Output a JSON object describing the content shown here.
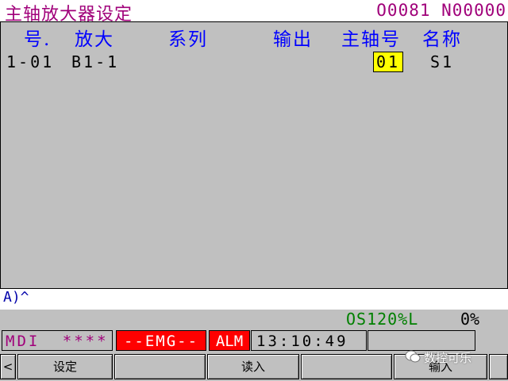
{
  "header": {
    "title": "主轴放大器设定",
    "program": "O0081 N00000"
  },
  "table": {
    "columns": {
      "no": "号.",
      "amp": "放大",
      "series": "系列",
      "output": "输出",
      "spindle": "主轴号",
      "name": "名称"
    },
    "rows": [
      {
        "no": "1-01",
        "amp": "B1-1",
        "series": "",
        "output": "",
        "spindle": "01",
        "name": "S1"
      }
    ]
  },
  "input": {
    "text": "A)^"
  },
  "status": {
    "os": "OS120%L",
    "spindle_load": "0%"
  },
  "modebar": {
    "mode": "MDI",
    "stars": "****",
    "emg": "--EMG--",
    "alm": "ALM",
    "time": "13:10:49"
  },
  "softkeys": {
    "left_arrow": "<",
    "k1": "设定",
    "k2": "",
    "k3": "读入",
    "k4": "",
    "k5": "输入",
    "right_arrow": ""
  },
  "watermark": "数控可乐",
  "colors": {
    "title": "#a0007a",
    "header_blue": "#0000ff",
    "os_green": "#008000",
    "emg_red": "#ff0000",
    "cursor_yellow": "#ffff00"
  }
}
